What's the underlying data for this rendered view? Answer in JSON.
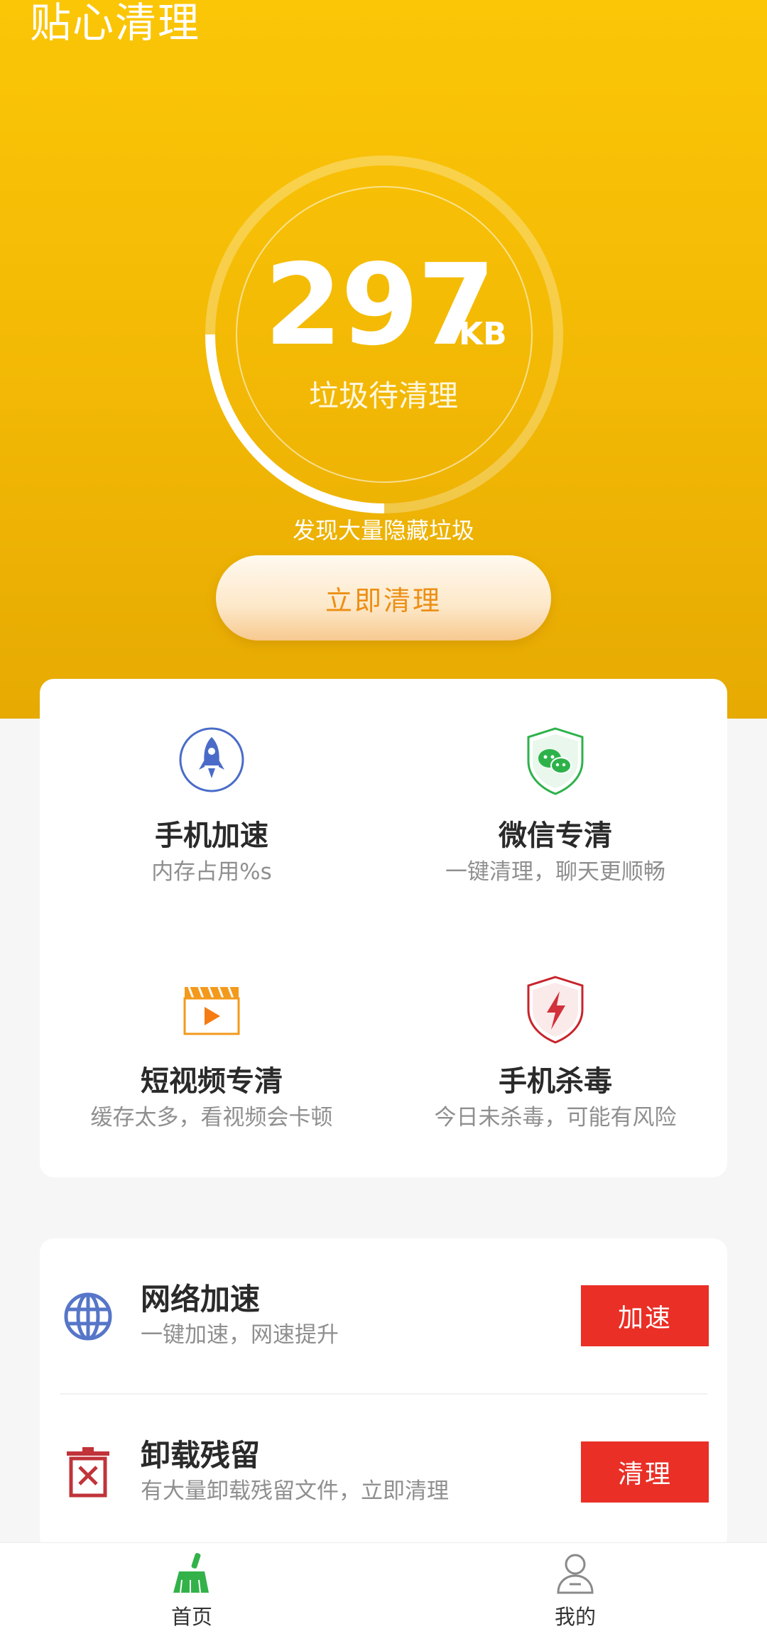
{
  "header": {
    "app_title": "贴心清理",
    "junk_size": "297",
    "junk_unit": "KB",
    "junk_label": "垃圾待清理",
    "hint": "发现大量隐藏垃圾",
    "clean_button": "立即清理",
    "progress_fraction": 0.2
  },
  "features": [
    {
      "title": "手机加速",
      "subtitle": "内存占用%s",
      "icon": "rocket-icon"
    },
    {
      "title": "微信专清",
      "subtitle": "一键清理，聊天更顺畅",
      "icon": "wechat-shield-icon"
    },
    {
      "title": "短视频专清",
      "subtitle": "缓存太多，看视频会卡顿",
      "icon": "video-clapper-icon"
    },
    {
      "title": "手机杀毒",
      "subtitle": "今日未杀毒，可能有风险",
      "icon": "lightning-shield-icon"
    }
  ],
  "list": [
    {
      "title": "网络加速",
      "subtitle": "一键加速，网速提升",
      "button": "加速",
      "icon": "globe-icon"
    },
    {
      "title": "卸载残留",
      "subtitle": "有大量卸载残留文件，立即清理",
      "button": "清理",
      "icon": "trash-box-icon"
    }
  ],
  "tabbar": {
    "home_label": "首页",
    "mine_label": "我的"
  },
  "colors": {
    "header_top": "#fbc606",
    "header_bottom": "#e6aa02",
    "action_red": "#ea2f26",
    "clean_text": "#ec8f14",
    "tab_active": "#33b24a"
  }
}
